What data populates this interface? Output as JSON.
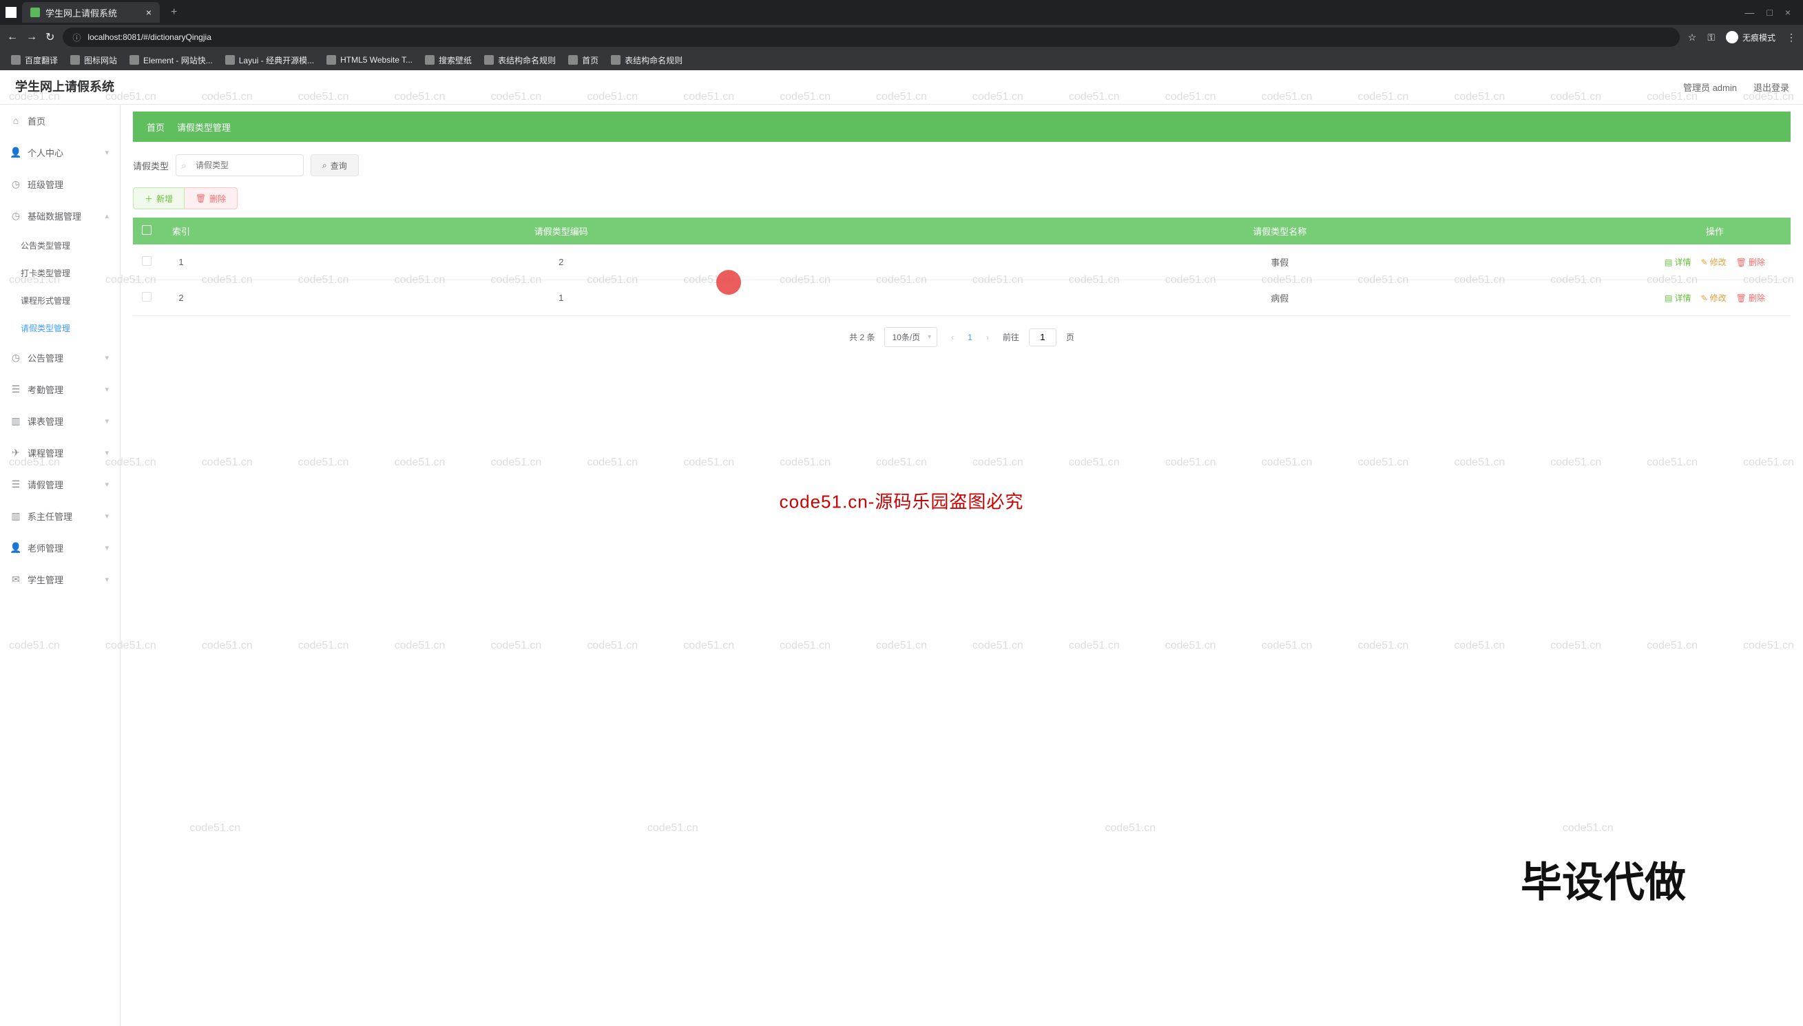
{
  "browser": {
    "tab_title": "学生网上请假系统",
    "url": "localhost:8081/#/dictionaryQingjia",
    "incognito_label": "无痕模式",
    "bookmarks": [
      "百度翻译",
      "图标网站",
      "Element - 网站快...",
      "Layui - 经典开源模...",
      "HTML5 Website T...",
      "搜索壁纸",
      "表结构命名规则",
      "首页",
      "表结构命名规则"
    ]
  },
  "header": {
    "app_title": "学生网上请假系统",
    "user_label": "管理员 admin",
    "logout_label": "退出登录"
  },
  "sidebar": [
    {
      "icon": "home",
      "label": "首页"
    },
    {
      "icon": "user",
      "label": "个人中心",
      "arrow": true
    },
    {
      "icon": "clock",
      "label": "班级管理"
    },
    {
      "icon": "gear",
      "label": "基础数据管理",
      "arrow": true,
      "expanded": true,
      "children": [
        {
          "label": "公告类型管理"
        },
        {
          "label": "打卡类型管理"
        },
        {
          "label": "课程形式管理"
        },
        {
          "label": "请假类型管理",
          "active": true
        }
      ]
    },
    {
      "icon": "clock",
      "label": "公告管理",
      "arrow": true
    },
    {
      "icon": "list",
      "label": "考勤管理",
      "arrow": true
    },
    {
      "icon": "cal",
      "label": "课表管理",
      "arrow": true
    },
    {
      "icon": "send",
      "label": "课程管理",
      "arrow": true
    },
    {
      "icon": "list",
      "label": "请假管理",
      "arrow": true
    },
    {
      "icon": "cal",
      "label": "系主任管理",
      "arrow": true
    },
    {
      "icon": "user",
      "label": "老师管理",
      "arrow": true
    },
    {
      "icon": "mail",
      "label": "学生管理",
      "arrow": true
    }
  ],
  "breadcrumb": {
    "home": "首页",
    "current": "请假类型管理"
  },
  "search": {
    "field_label": "请假类型",
    "placeholder": "请假类型",
    "query_btn": "查询"
  },
  "action_buttons": {
    "add": "新增",
    "delete": "删除"
  },
  "table": {
    "headers": [
      "",
      "索引",
      "请假类型编码",
      "请假类型名称",
      "操作"
    ],
    "rows": [
      {
        "index": "1",
        "code": "2",
        "name": "事假"
      },
      {
        "index": "2",
        "code": "1",
        "name": "病假"
      }
    ],
    "row_actions": {
      "detail": "详情",
      "edit": "修改",
      "delete": "删除"
    }
  },
  "pagination": {
    "total_label": "共 2 条",
    "per_page": "10条/页",
    "current": "1",
    "goto_prefix": "前往",
    "goto_value": "1",
    "goto_suffix": "页"
  },
  "watermark_text": "code51.cn",
  "center_banner": "code51.cn-源码乐园盗图必究",
  "corner_banner": "毕设代做"
}
